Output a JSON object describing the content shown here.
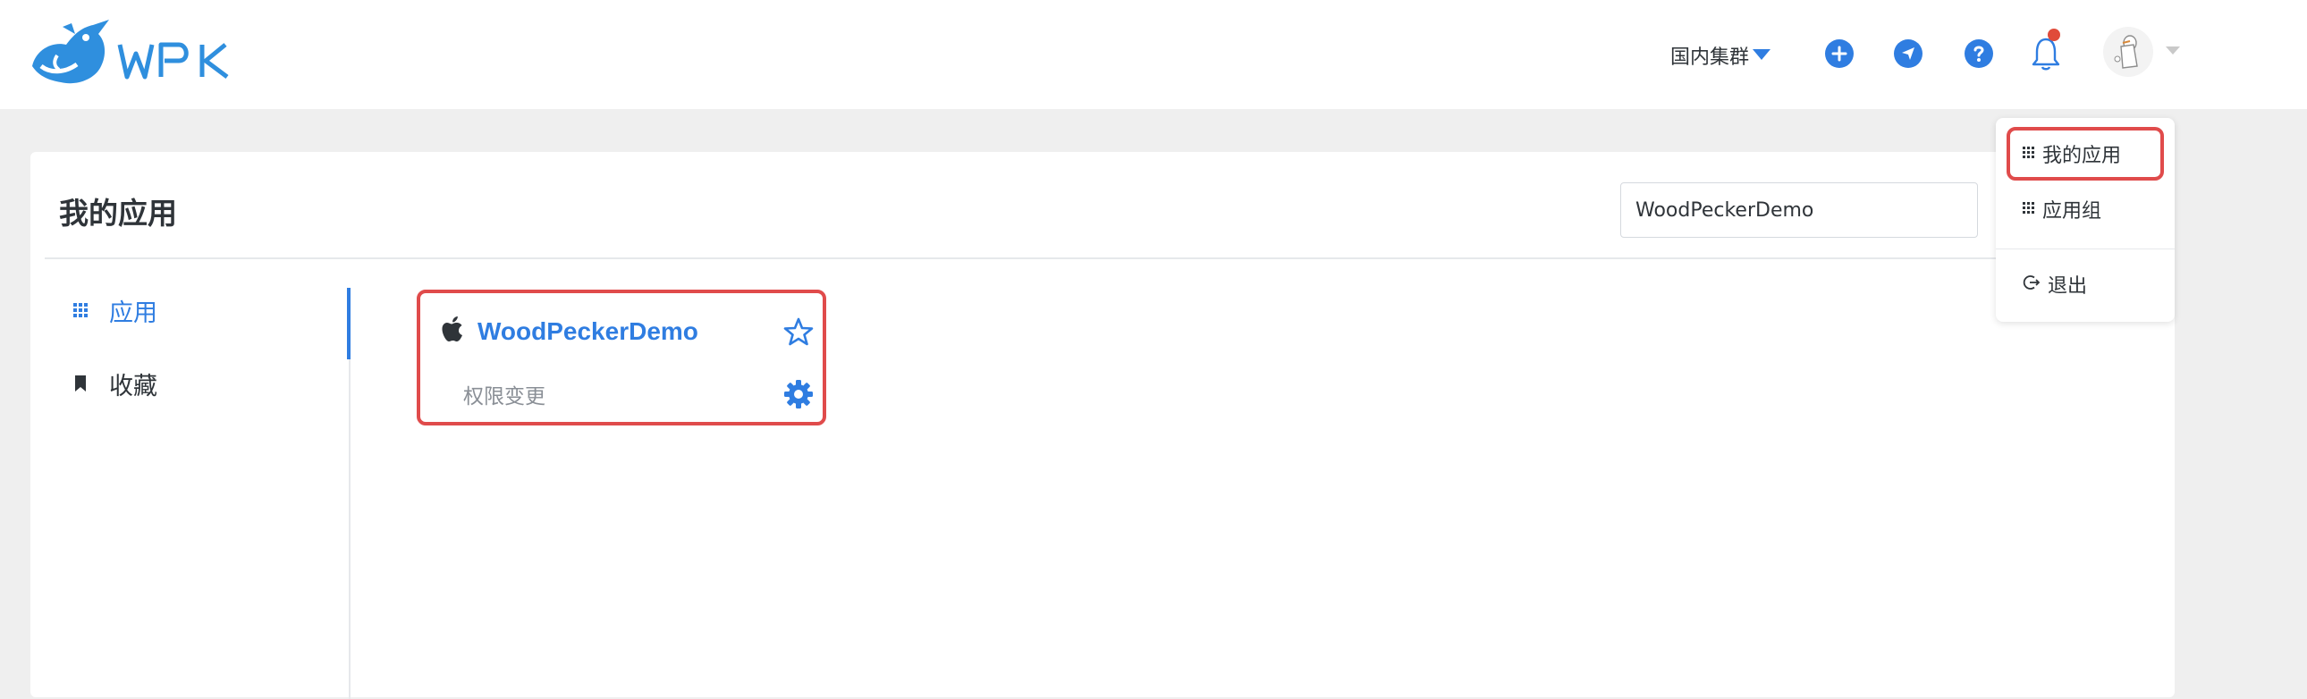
{
  "header": {
    "logo_text": "WPK",
    "cluster_label": "国内集群"
  },
  "icons": {
    "add": "plus-circle-icon",
    "send": "send-icon",
    "help": "help-icon",
    "notification": "bell-icon",
    "user": "avatar"
  },
  "main": {
    "title": "我的应用",
    "search": {
      "value": "WoodPeckerDemo",
      "placeholder": ""
    }
  },
  "sidebar": {
    "items": [
      {
        "label": "应用",
        "icon": "grid-icon",
        "active": true
      },
      {
        "label": "收藏",
        "icon": "bookmark-icon",
        "active": false
      }
    ]
  },
  "app_card": {
    "name": "WoodPeckerDemo",
    "subtitle": "权限变更",
    "platform_icon": "apple-icon"
  },
  "user_menu": {
    "items": [
      {
        "label": "我的应用",
        "icon": "grid-icon"
      },
      {
        "label": "应用组",
        "icon": "grid-icon"
      },
      {
        "label": "退出",
        "icon": "logout-icon"
      }
    ]
  },
  "colors": {
    "accent": "#2f7de1",
    "highlight": "#e04b4b",
    "notification_dot": "#e04b3a"
  }
}
